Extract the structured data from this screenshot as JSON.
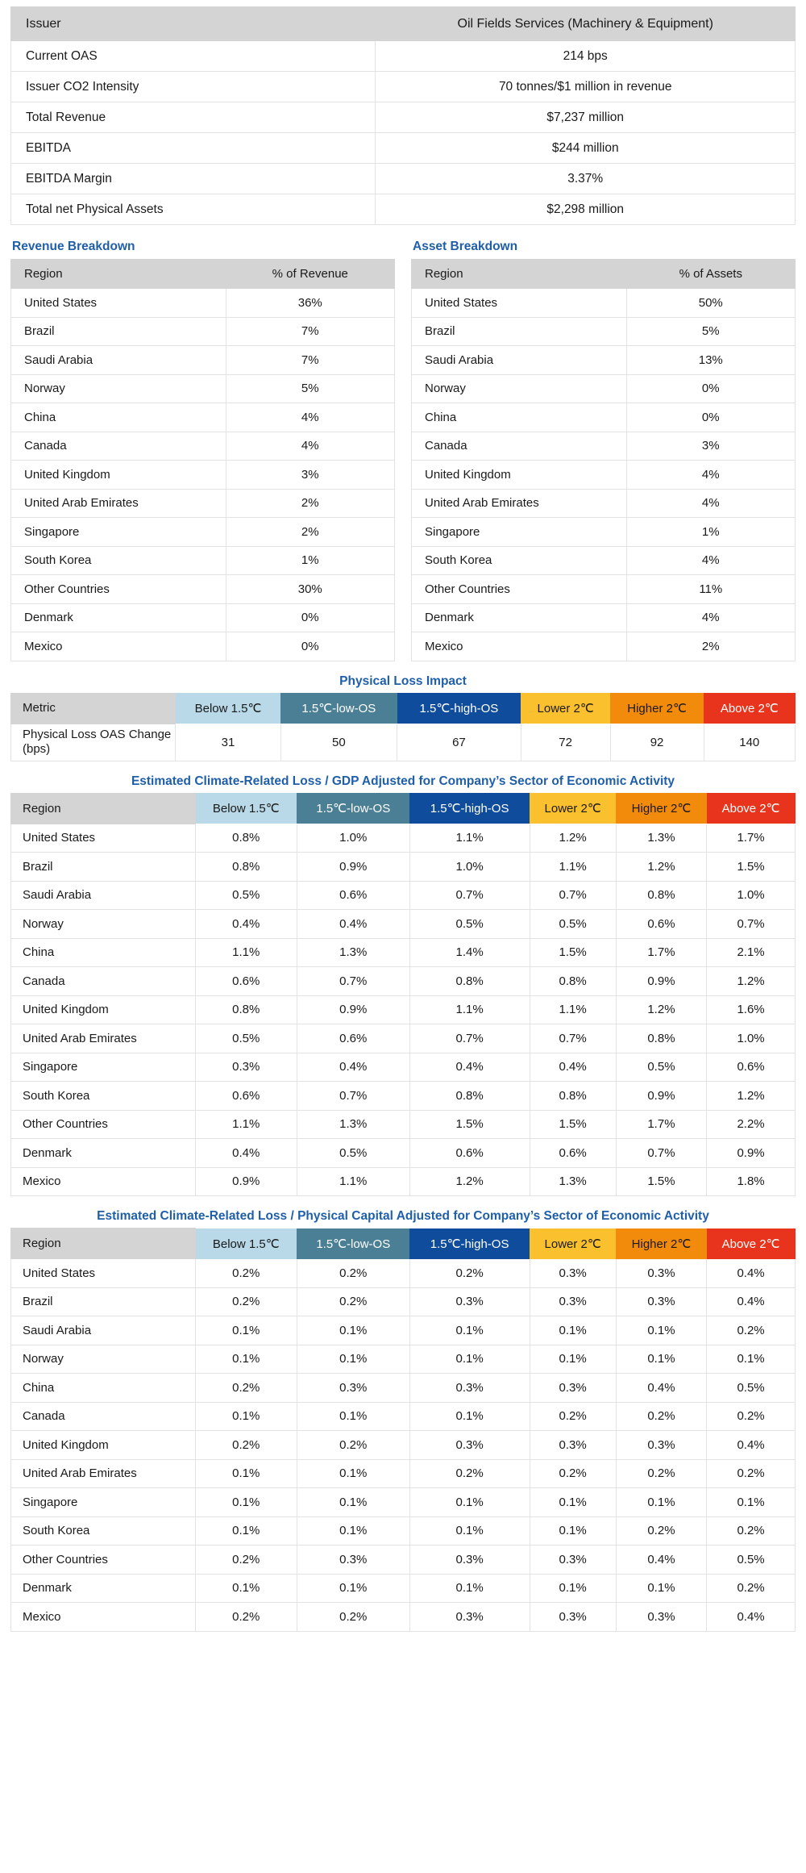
{
  "issuer_table": {
    "header": {
      "label": "Issuer",
      "value": "Oil Fields Services (Machinery & Equipment)"
    },
    "rows": [
      {
        "label": "Current OAS",
        "value": "214 bps"
      },
      {
        "label": "Issuer CO2 Intensity",
        "value": "70 tonnes/$1 million in revenue"
      },
      {
        "label": "Total Revenue",
        "value": "$7,237 million"
      },
      {
        "label": "EBITDA",
        "value": "$244 million"
      },
      {
        "label": "EBITDA Margin",
        "value": "3.37%"
      },
      {
        "label": "Total net Physical Assets",
        "value": "$2,298 million"
      }
    ]
  },
  "revenue_breakdown": {
    "title": "Revenue Breakdown",
    "columns": [
      "Region",
      "% of Revenue"
    ],
    "rows": [
      {
        "region": "United States",
        "pct": "36%"
      },
      {
        "region": "Brazil",
        "pct": "7%"
      },
      {
        "region": "Saudi Arabia",
        "pct": "7%"
      },
      {
        "region": "Norway",
        "pct": "5%"
      },
      {
        "region": "China",
        "pct": "4%"
      },
      {
        "region": "Canada",
        "pct": "4%"
      },
      {
        "region": "United Kingdom",
        "pct": "3%"
      },
      {
        "region": "United Arab Emirates",
        "pct": "2%"
      },
      {
        "region": "Singapore",
        "pct": "2%"
      },
      {
        "region": "South Korea",
        "pct": "1%"
      },
      {
        "region": "Other Countries",
        "pct": "30%"
      },
      {
        "region": "Denmark",
        "pct": "0%"
      },
      {
        "region": "Mexico",
        "pct": "0%"
      }
    ]
  },
  "asset_breakdown": {
    "title": "Asset Breakdown",
    "columns": [
      "Region",
      "% of Assets"
    ],
    "rows": [
      {
        "region": "United States",
        "pct": "50%"
      },
      {
        "region": "Brazil",
        "pct": "5%"
      },
      {
        "region": "Saudi Arabia",
        "pct": "13%"
      },
      {
        "region": "Norway",
        "pct": "0%"
      },
      {
        "region": "China",
        "pct": "0%"
      },
      {
        "region": "Canada",
        "pct": "3%"
      },
      {
        "region": "United Kingdom",
        "pct": "4%"
      },
      {
        "region": "United Arab Emirates",
        "pct": "4%"
      },
      {
        "region": "Singapore",
        "pct": "1%"
      },
      {
        "region": "South Korea",
        "pct": "4%"
      },
      {
        "region": "Other Countries",
        "pct": "11%"
      },
      {
        "region": "Denmark",
        "pct": "4%"
      },
      {
        "region": "Mexico",
        "pct": "2%"
      }
    ]
  },
  "scenarios": [
    {
      "label": "Below 1.5℃",
      "color": "#b9d9e8"
    },
    {
      "label": "1.5℃-low-OS",
      "color": "#4a7f96"
    },
    {
      "label": "1.5℃-high-OS",
      "color": "#0f4c9b"
    },
    {
      "label": "Lower 2℃",
      "color": "#fbc02d"
    },
    {
      "label": "Higher 2℃",
      "color": "#f28b0c"
    },
    {
      "label": "Above 2℃",
      "color": "#e8341c"
    }
  ],
  "physical_loss_impact": {
    "title": "Physical Loss Impact",
    "first_column_header": "Metric",
    "rows": [
      {
        "label": "Physical Loss OAS Change (bps)",
        "values": [
          "31",
          "50",
          "67",
          "72",
          "92",
          "140"
        ]
      }
    ]
  },
  "gdp_table": {
    "title": "Estimated Climate-Related Loss / GDP Adjusted for Company’s Sector of Economic Activity",
    "first_column_header": "Region",
    "rows": [
      {
        "label": "United States",
        "values": [
          "0.8%",
          "1.0%",
          "1.1%",
          "1.2%",
          "1.3%",
          "1.7%"
        ]
      },
      {
        "label": "Brazil",
        "values": [
          "0.8%",
          "0.9%",
          "1.0%",
          "1.1%",
          "1.2%",
          "1.5%"
        ]
      },
      {
        "label": "Saudi Arabia",
        "values": [
          "0.5%",
          "0.6%",
          "0.7%",
          "0.7%",
          "0.8%",
          "1.0%"
        ]
      },
      {
        "label": "Norway",
        "values": [
          "0.4%",
          "0.4%",
          "0.5%",
          "0.5%",
          "0.6%",
          "0.7%"
        ]
      },
      {
        "label": "China",
        "values": [
          "1.1%",
          "1.3%",
          "1.4%",
          "1.5%",
          "1.7%",
          "2.1%"
        ]
      },
      {
        "label": "Canada",
        "values": [
          "0.6%",
          "0.7%",
          "0.8%",
          "0.8%",
          "0.9%",
          "1.2%"
        ]
      },
      {
        "label": "United Kingdom",
        "values": [
          "0.8%",
          "0.9%",
          "1.1%",
          "1.1%",
          "1.2%",
          "1.6%"
        ]
      },
      {
        "label": "United Arab Emirates",
        "values": [
          "0.5%",
          "0.6%",
          "0.7%",
          "0.7%",
          "0.8%",
          "1.0%"
        ]
      },
      {
        "label": "Singapore",
        "values": [
          "0.3%",
          "0.4%",
          "0.4%",
          "0.4%",
          "0.5%",
          "0.6%"
        ]
      },
      {
        "label": "South Korea",
        "values": [
          "0.6%",
          "0.7%",
          "0.8%",
          "0.8%",
          "0.9%",
          "1.2%"
        ]
      },
      {
        "label": "Other Countries",
        "values": [
          "1.1%",
          "1.3%",
          "1.5%",
          "1.5%",
          "1.7%",
          "2.2%"
        ]
      },
      {
        "label": "Denmark",
        "values": [
          "0.4%",
          "0.5%",
          "0.6%",
          "0.6%",
          "0.7%",
          "0.9%"
        ]
      },
      {
        "label": "Mexico",
        "values": [
          "0.9%",
          "1.1%",
          "1.2%",
          "1.3%",
          "1.5%",
          "1.8%"
        ]
      }
    ]
  },
  "capital_table": {
    "title": "Estimated Climate-Related Loss / Physical Capital Adjusted for Company’s Sector of Economic Activity",
    "first_column_header": "Region",
    "rows": [
      {
        "label": "United States",
        "values": [
          "0.2%",
          "0.2%",
          "0.2%",
          "0.3%",
          "0.3%",
          "0.4%"
        ]
      },
      {
        "label": "Brazil",
        "values": [
          "0.2%",
          "0.2%",
          "0.3%",
          "0.3%",
          "0.3%",
          "0.4%"
        ]
      },
      {
        "label": "Saudi Arabia",
        "values": [
          "0.1%",
          "0.1%",
          "0.1%",
          "0.1%",
          "0.1%",
          "0.2%"
        ]
      },
      {
        "label": "Norway",
        "values": [
          "0.1%",
          "0.1%",
          "0.1%",
          "0.1%",
          "0.1%",
          "0.1%"
        ]
      },
      {
        "label": "China",
        "values": [
          "0.2%",
          "0.3%",
          "0.3%",
          "0.3%",
          "0.4%",
          "0.5%"
        ]
      },
      {
        "label": "Canada",
        "values": [
          "0.1%",
          "0.1%",
          "0.1%",
          "0.2%",
          "0.2%",
          "0.2%"
        ]
      },
      {
        "label": "United Kingdom",
        "values": [
          "0.2%",
          "0.2%",
          "0.3%",
          "0.3%",
          "0.3%",
          "0.4%"
        ]
      },
      {
        "label": "United Arab Emirates",
        "values": [
          "0.1%",
          "0.1%",
          "0.2%",
          "0.2%",
          "0.2%",
          "0.2%"
        ]
      },
      {
        "label": "Singapore",
        "values": [
          "0.1%",
          "0.1%",
          "0.1%",
          "0.1%",
          "0.1%",
          "0.1%"
        ]
      },
      {
        "label": "South Korea",
        "values": [
          "0.1%",
          "0.1%",
          "0.1%",
          "0.1%",
          "0.2%",
          "0.2%"
        ]
      },
      {
        "label": "Other Countries",
        "values": [
          "0.2%",
          "0.3%",
          "0.3%",
          "0.3%",
          "0.4%",
          "0.5%"
        ]
      },
      {
        "label": "Denmark",
        "values": [
          "0.1%",
          "0.1%",
          "0.1%",
          "0.1%",
          "0.1%",
          "0.2%"
        ]
      },
      {
        "label": "Mexico",
        "values": [
          "0.2%",
          "0.2%",
          "0.3%",
          "0.3%",
          "0.3%",
          "0.4%"
        ]
      }
    ]
  }
}
